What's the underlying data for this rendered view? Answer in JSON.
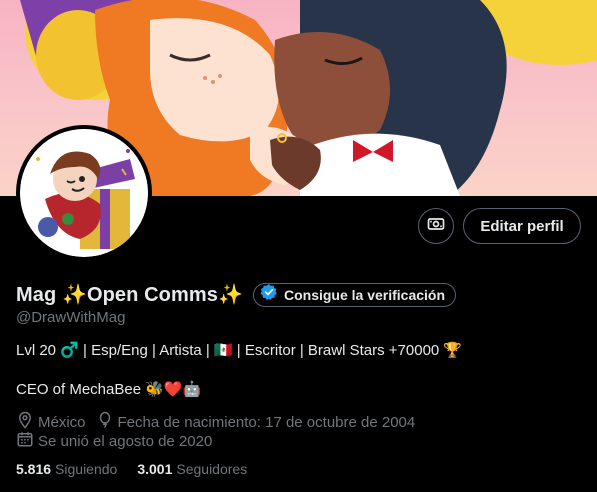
{
  "header": {
    "edit_profile_label": "Editar perfil",
    "money_icon": "money-icon"
  },
  "profile": {
    "display_name": "Mag ✨Open Comms✨",
    "verification_label": "Consigue la verificación",
    "handle": "@DrawWithMag",
    "bio_line_1": "Lvl 20 ♂️ | Esp/Eng | Artista | 🇲🇽 | Escritor |  Brawl Stars +70000 🏆",
    "bio_line_2": "CEO of MechaBee 🐝❤️🤖",
    "location": "México",
    "birthday": "Fecha de nacimiento: 17 de octubre de 2004",
    "joined": "Se unió el agosto de 2020"
  },
  "stats": {
    "following_count": "5.816",
    "following_label": "Siguiendo",
    "followers_count": "3.001",
    "followers_label": "Seguidores"
  },
  "colors": {
    "background": "#000000",
    "text_primary": "#e7e9ea",
    "text_secondary": "#71767b",
    "border": "#536471",
    "verified_blue": "#1d9bf0"
  }
}
